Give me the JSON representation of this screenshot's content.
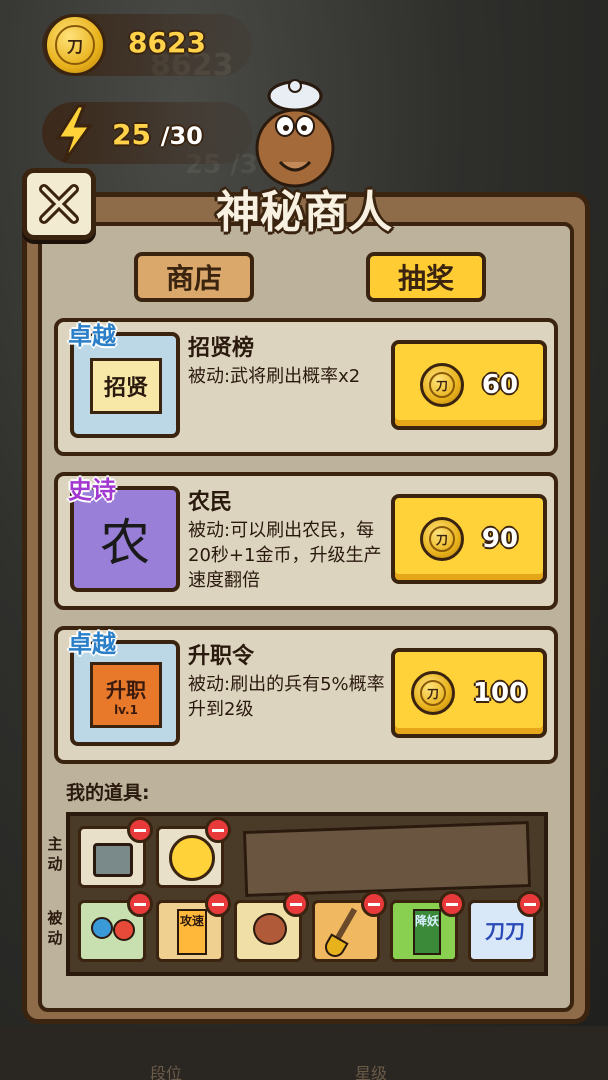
{
  "resources": {
    "coins": "8623",
    "energy_current": "25",
    "energy_max": "/30",
    "coin_glyph": "刀"
  },
  "background": {
    "ghost_coins": "8623",
    "ghost_energy": "25 /3"
  },
  "dialog": {
    "title": "神秘商人",
    "tabs": [
      {
        "label": "商店",
        "active": false
      },
      {
        "label": "抽奖",
        "active": true
      }
    ]
  },
  "offers": [
    {
      "rarity": "卓越",
      "rarity_color": "#2a7fc8",
      "icon_name": "recruit-scroll-icon",
      "icon_text": "招贤",
      "name": "招贤榜",
      "description": "被动:武将刷出概率x2",
      "price": "60"
    },
    {
      "rarity": "史诗",
      "rarity_color": "#a238d0",
      "icon_name": "farmer-tile-icon",
      "icon_text": "农",
      "name": "农民",
      "description": "被动:可以刷出农民，每20秒+1金币，升级生产速度翻倍",
      "price": "90"
    },
    {
      "rarity": "卓越",
      "rarity_color": "#2a7fc8",
      "icon_name": "promotion-scroll-icon",
      "icon_text": "升职",
      "icon_subtext": "lv.1",
      "name": "升职令",
      "description": "被动:刷出的兵有5%概率升到2级",
      "price": "100"
    }
  ],
  "inventory": {
    "label": "我的道具:",
    "active_label": "主动",
    "passive_label": "被动",
    "active_items": [
      {
        "icon": "cauldron-icon"
      },
      {
        "icon": "bow-arrow-icon"
      }
    ],
    "passive_items": [
      {
        "icon": "gem-boost-icon"
      },
      {
        "icon": "attack-speed-card-icon",
        "text": "攻速"
      },
      {
        "icon": "meat-icon"
      },
      {
        "icon": "shovel-icon"
      },
      {
        "icon": "demon-seal-icon",
        "text": "降妖"
      },
      {
        "icon": "blade-card-icon",
        "text": "刀刀"
      }
    ]
  },
  "bottom_nav": [
    "段位",
    "星级"
  ]
}
